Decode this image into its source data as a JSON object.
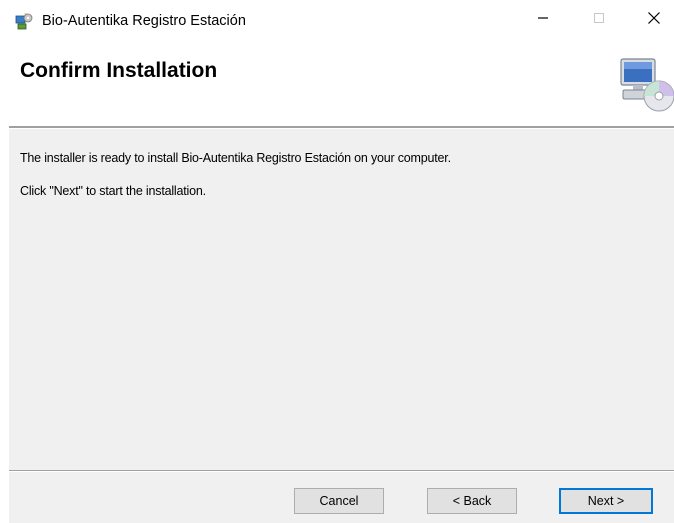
{
  "window": {
    "title": "Bio-Autentika Registro Estación",
    "app_icon": "installer-icon",
    "controls": {
      "minimize_icon": "minimize-icon",
      "maximize_icon": "maximize-icon",
      "close_icon": "close-icon"
    }
  },
  "header": {
    "title": "Confirm Installation",
    "icon": "computer-cd-icon"
  },
  "content": {
    "line1": "The installer is ready to install Bio-Autentika Registro Estación on your computer.",
    "line2": "Click \"Next\" to start the installation."
  },
  "buttons": {
    "cancel": "Cancel",
    "back": "< Back",
    "next": "Next >"
  },
  "colors": {
    "dialog_background": "#f0f0f0",
    "header_background": "#ffffff",
    "default_button_border": "#0078d7"
  }
}
